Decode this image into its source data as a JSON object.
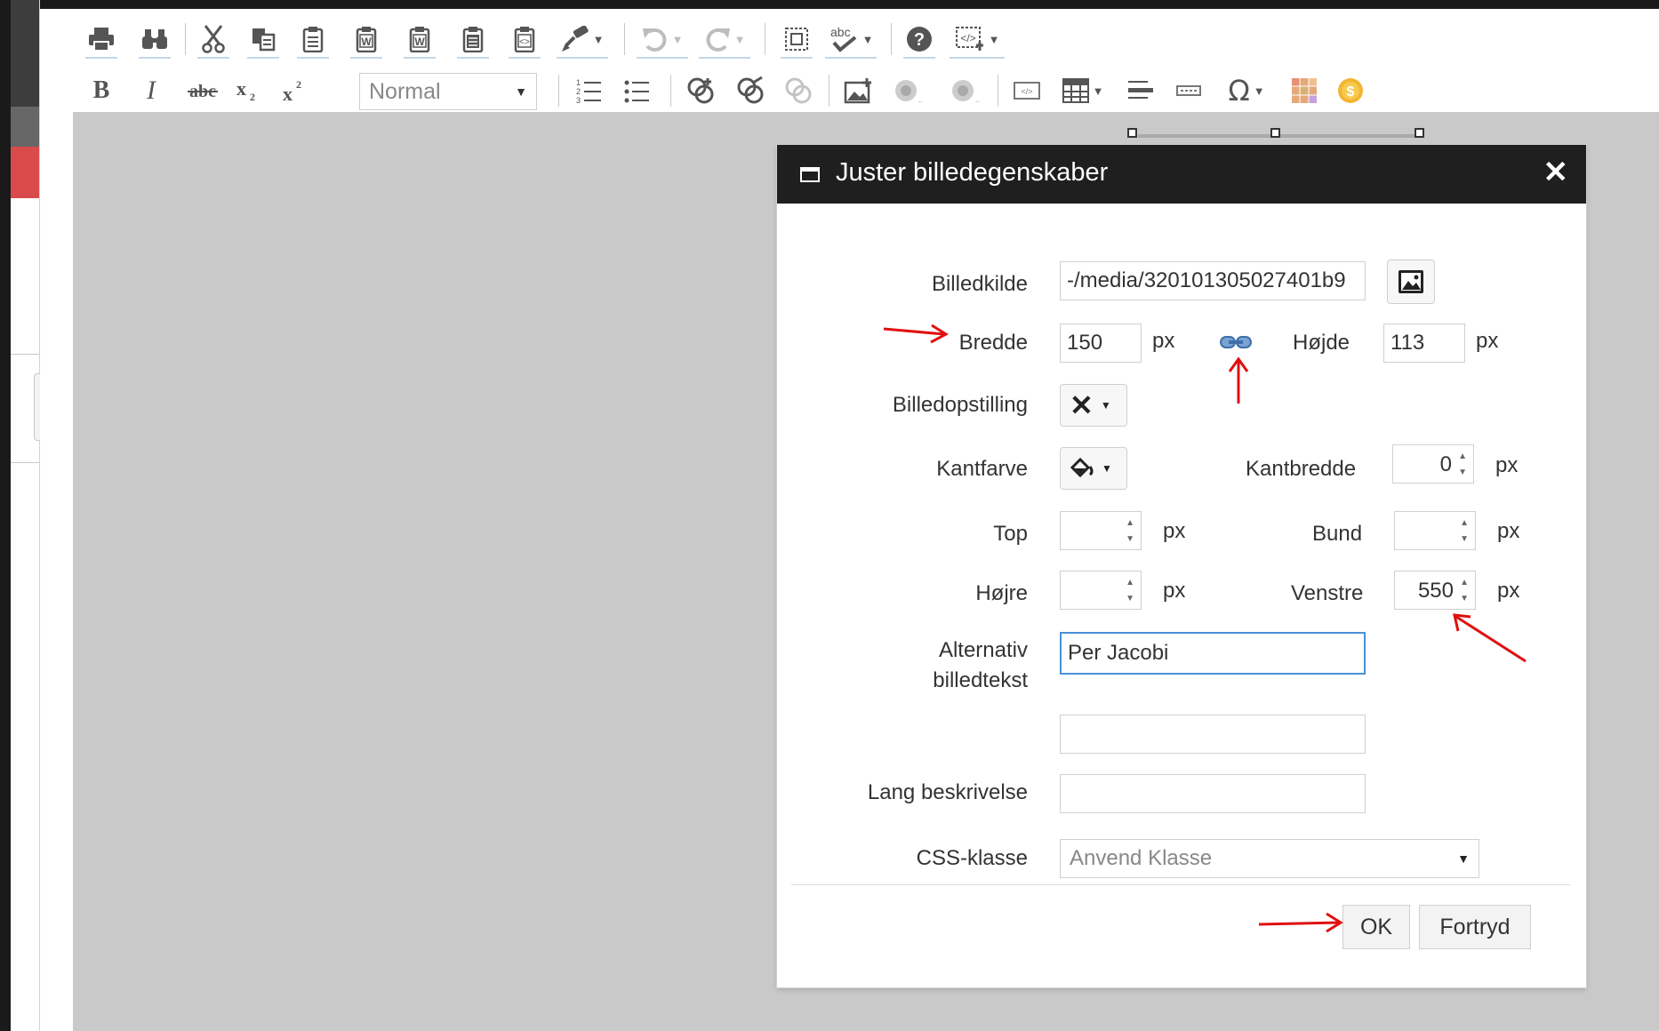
{
  "toolbar": {
    "format_select": "Normal",
    "row1_icons": [
      "print-icon",
      "find-icon",
      "cut-icon",
      "copy-icon",
      "paste-icon",
      "paste-word-icon",
      "paste-word-alt-icon",
      "paste-text-icon",
      "paste-html-icon",
      "format-painter-icon",
      "undo-icon",
      "redo-icon",
      "select-all-icon",
      "spellcheck-icon",
      "help-icon",
      "source-code-icon"
    ],
    "row2_icons": [
      "bold-icon",
      "italic-icon",
      "strikethrough-icon",
      "subscript-icon",
      "superscript-icon",
      "ordered-list-icon",
      "unordered-list-icon",
      "insert-link-icon",
      "edit-link-icon",
      "unlink-icon",
      "insert-image-icon",
      "insert-flash-icon",
      "insert-media-icon",
      "insert-snippet-icon",
      "table-icon",
      "horizontal-rule-icon",
      "page-break-icon",
      "special-char-icon",
      "color-grid-icon",
      "coin-icon"
    ]
  },
  "dialog": {
    "title": "Juster billedegenskaber",
    "close_glyph": "✕",
    "fields": {
      "billedkilde_label": "Billedkilde",
      "billedkilde_value": "-/media/320101305027401b9",
      "bredde_label": "Bredde",
      "bredde_value": "150",
      "hojde_label": "Højde",
      "hojde_value": "113",
      "unit": "px",
      "billedopstilling_label": "Billedopstilling",
      "kantfarve_label": "Kantfarve",
      "kantbredde_label": "Kantbredde",
      "kantbredde_value": "0",
      "top_label": "Top",
      "top_value": "",
      "bund_label": "Bund",
      "bund_value": "",
      "hojre_label": "Højre",
      "hojre_value": "",
      "venstre_label": "Venstre",
      "venstre_value": "550",
      "alt_label_line1": "Alternativ",
      "alt_label_line2": "billedtekst",
      "alt_value": "Per Jacobi",
      "extra_value": "",
      "lang_label": "Lang beskrivelse",
      "lang_value": "",
      "css_label": "CSS-klasse",
      "css_placeholder": "Anvend Klasse"
    },
    "buttons": {
      "ok": "OK",
      "cancel": "Fortryd"
    }
  },
  "annotation_color": "#e01010"
}
